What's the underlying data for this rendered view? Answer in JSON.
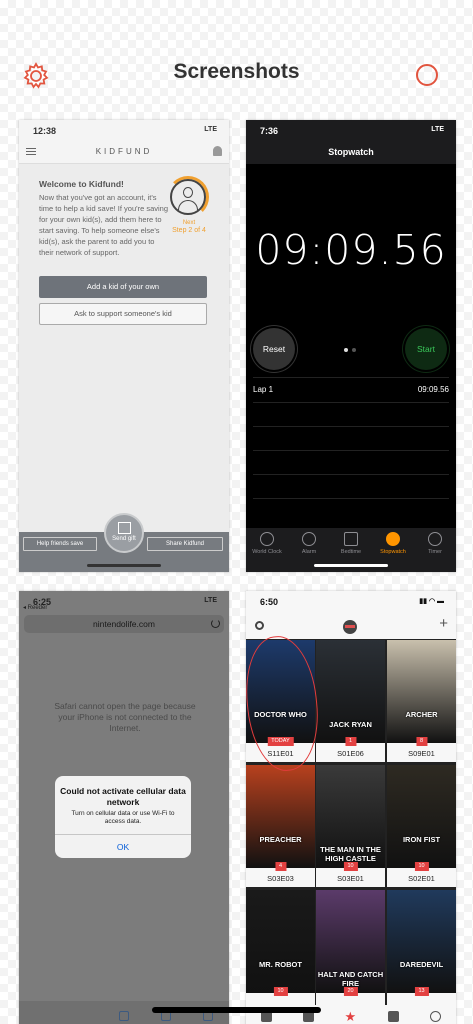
{
  "header": {
    "title": "Screenshots",
    "settings_icon": "gear-icon",
    "record_icon": "record-circle-icon",
    "accent": "#e2553f"
  },
  "cards": {
    "kidfund": {
      "time": "12:38",
      "signal": "LTE",
      "app_title": "KIDFUND",
      "welcome": "Welcome to Kidfund!",
      "body": "Now that you've got an account, it's time to help a kid save! If you're saving for your own kid(s), add them here to start saving. To help someone else's kid(s), ask the parent to add you to their network of support.",
      "next": "Next",
      "step": "Step 2 of 4",
      "primary_btn": "Add a kid of your own",
      "secondary_btn": "Ask to support someone's kid",
      "footer_left": "Help friends save",
      "footer_center": "Send gift",
      "footer_right": "Share Kidfund"
    },
    "stopwatch": {
      "time": "7:36",
      "signal": "LTE",
      "title": "Stopwatch",
      "display": "09:09.56",
      "reset": "Reset",
      "start": "Start",
      "lap_label": "Lap 1",
      "lap_time": "09:09.56",
      "tabs": [
        {
          "label": "World Clock",
          "icon": "globe-icon"
        },
        {
          "label": "Alarm",
          "icon": "alarm-clock-icon"
        },
        {
          "label": "Bedtime",
          "icon": "bed-icon"
        },
        {
          "label": "Stopwatch",
          "icon": "stopwatch-icon"
        },
        {
          "label": "Timer",
          "icon": "timer-icon"
        }
      ],
      "active_color": "#ff9500"
    },
    "safari": {
      "time": "6:25",
      "signal": "LTE",
      "back_label": "◂ Reeder",
      "url": "nintendolife.com",
      "message": "Safari cannot open the page because your iPhone is not connected to the Internet.",
      "alert_title": "Could not activate cellular data network",
      "alert_message": "Turn on cellular data or use Wi-Fi to access data.",
      "alert_ok": "OK"
    },
    "tv": {
      "time": "6:50",
      "shows": [
        {
          "poster": "DOCTOR WHO",
          "badge": "TODAY",
          "episode": "S11E01",
          "color": "#1d3a6b"
        },
        {
          "poster": "JACK RYAN",
          "badge": "1",
          "episode": "S01E06",
          "color": "#2b3036"
        },
        {
          "poster": "ARCHER",
          "badge": "8",
          "episode": "S09E01",
          "color": "#c9c0ad"
        },
        {
          "poster": "PREACHER",
          "badge": "4",
          "episode": "S03E03",
          "color": "#b8411e"
        },
        {
          "poster": "THE MAN IN THE HIGH CASTLE",
          "badge": "10",
          "episode": "S03E01",
          "color": "#3a3a3a"
        },
        {
          "poster": "IRON FIST",
          "badge": "10",
          "episode": "S02E01",
          "color": "#2e2a22"
        },
        {
          "poster": "MR. ROBOT",
          "badge": "10",
          "episode": "",
          "color": "#1a1a1a"
        },
        {
          "poster": "HALT AND CATCH FIRE",
          "badge": "20",
          "episode": "",
          "color": "#5b3b6a"
        },
        {
          "poster": "DAREDEVIL",
          "badge": "13",
          "episode": "",
          "color": "#203a5c"
        }
      ]
    }
  }
}
